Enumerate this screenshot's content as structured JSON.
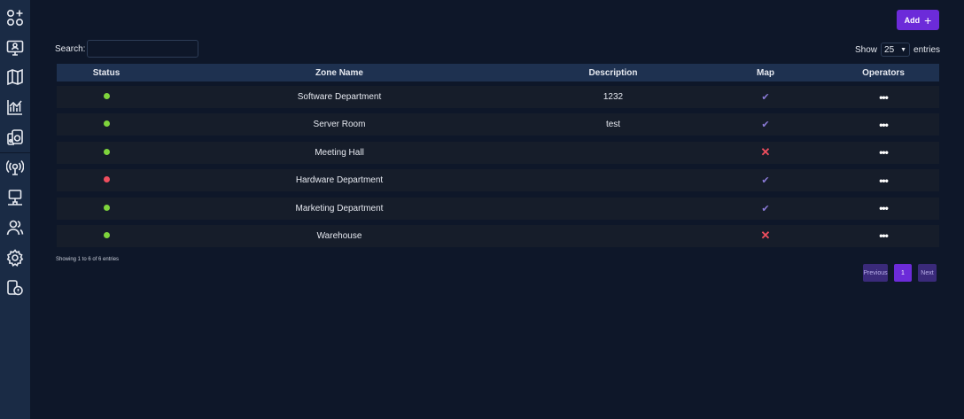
{
  "sidebar": {
    "icons": [
      "widgets-add-icon",
      "monitor-user-icon",
      "map-icon",
      "chart-icon",
      "devices-icon",
      "radar-icon",
      "network-icon",
      "users-icon",
      "settings-icon",
      "device-info-icon"
    ]
  },
  "toolbar": {
    "add_label": "Add",
    "add_icon": "+"
  },
  "search": {
    "label": "Search:",
    "value": ""
  },
  "length_menu": {
    "show_label": "Show",
    "value": "25",
    "entries_label": "entries"
  },
  "table": {
    "headers": {
      "status": "Status",
      "zone_name": "Zone Name",
      "description": "Description",
      "map": "Map",
      "operators": "Operators"
    },
    "rows": [
      {
        "status": "green",
        "zone_name": "Software Department",
        "description": "1232",
        "map": "check",
        "ops": "•••"
      },
      {
        "status": "green",
        "zone_name": "Server Room",
        "description": "test",
        "map": "check",
        "ops": "•••"
      },
      {
        "status": "green",
        "zone_name": "Meeting Hall",
        "description": "",
        "map": "cross",
        "ops": "•••"
      },
      {
        "status": "red",
        "zone_name": "Hardware Department",
        "description": "",
        "map": "check",
        "ops": "•••"
      },
      {
        "status": "green",
        "zone_name": "Marketing Department",
        "description": "",
        "map": "check",
        "ops": "•••"
      },
      {
        "status": "green",
        "zone_name": "Warehouse",
        "description": "",
        "map": "cross",
        "ops": "•••"
      }
    ]
  },
  "info_text": "Showing 1 to 6 of 6 entries",
  "pagination": {
    "previous": "Previous",
    "current": "1",
    "next": "Next"
  },
  "colors": {
    "status_green": "#7ed43c",
    "status_red": "#ef4e5e",
    "accent": "#6c2bd9",
    "map_check": "#8a7ad6",
    "map_cross": "#ef4e5e"
  }
}
